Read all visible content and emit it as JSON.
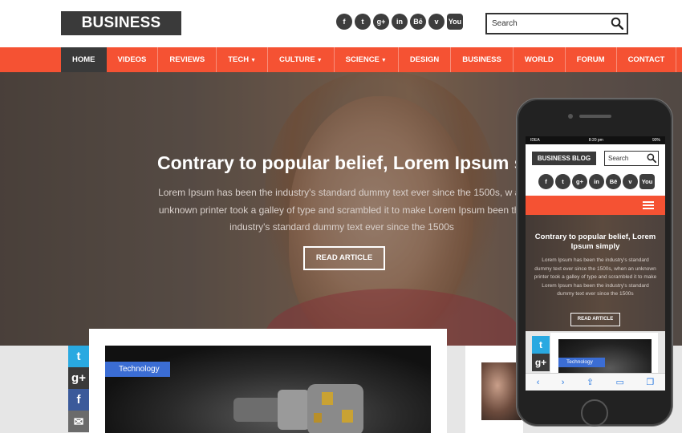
{
  "site": {
    "logo": "BUSINESS BLOG",
    "search_placeholder": "Search"
  },
  "social": [
    {
      "icon": "facebook-icon",
      "glyph": "f"
    },
    {
      "icon": "twitter-icon",
      "glyph": "t"
    },
    {
      "icon": "google-plus-icon",
      "glyph": "g+"
    },
    {
      "icon": "linkedin-icon",
      "glyph": "in"
    },
    {
      "icon": "behance-icon",
      "glyph": "Bē"
    },
    {
      "icon": "vimeo-icon",
      "glyph": "v"
    },
    {
      "icon": "youtube-icon",
      "glyph": "You"
    }
  ],
  "nav": {
    "items": [
      "HOME",
      "VIDEOS",
      "REVIEWS",
      "TECH",
      "CULTURE",
      "SCIENCE",
      "DESIGN",
      "BUSINESS",
      "WORLD",
      "FORUM",
      "CONTACT"
    ],
    "dropdown_items": [
      "TECH",
      "CULTURE",
      "SCIENCE"
    ],
    "active": "HOME"
  },
  "hero": {
    "title": "Contrary to popular belief, Lorem Ipsum simp",
    "text": "Lorem Ipsum has been the industry's standard dummy text ever since the 1500s, w an unknown printer took a galley of type and scrambled it to make Lorem Ipsum been the industry's standard dummy text ever since the 1500s",
    "button": "READ ARTICLE"
  },
  "share": [
    {
      "icon": "twitter-icon",
      "glyph": "t",
      "color": "#29a9e1"
    },
    {
      "icon": "google-plus-icon",
      "glyph": "g+",
      "color": "#3a3a3a"
    },
    {
      "icon": "facebook-icon",
      "glyph": "f",
      "color": "#3b5a9a"
    },
    {
      "icon": "mail-icon",
      "glyph": "✉",
      "color": "#6b6b6b"
    }
  ],
  "post": {
    "category": "Technology"
  },
  "mobile": {
    "status": {
      "carrier": "IDEA",
      "time": "8:20 pm",
      "battery": "90%"
    },
    "logo": "BUSINESS BLOG",
    "search": "Search",
    "hero_title": "Contrary to popular belief, Lorem Ipsum simply",
    "hero_text": "Lorem Ipsum has been the industry's standard dummy text ever since the 1500s, when an unknown printer took a galley of type and scrambled it to make Lorem Ipsum has been the industry's standard dummy text ever since the 1500s",
    "button": "READ ARTICLE",
    "category": "Technology"
  },
  "colors": {
    "accent": "#f55233",
    "dark": "#3a3a3a",
    "tag": "#3b6dd4"
  }
}
